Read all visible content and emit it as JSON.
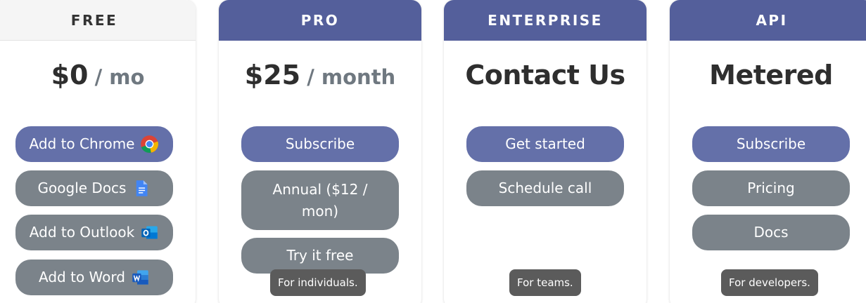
{
  "plans": {
    "free": {
      "header": "FREE",
      "price_amount": "$0",
      "price_period": "/ mo",
      "buttons": [
        "Add to Chrome",
        "Google Docs",
        "Add to Outlook",
        "Add to Word"
      ],
      "icons": [
        "chrome-icon",
        "google-docs-icon",
        "outlook-icon",
        "word-icon"
      ]
    },
    "pro": {
      "header": "PRO",
      "price_amount": "$25",
      "price_period": "/ month",
      "buttons": [
        "Subscribe",
        "Annual ($12 / mon)",
        "Try it free"
      ],
      "badge": "For individuals."
    },
    "enterprise": {
      "header": "ENTERPRISE",
      "price_text": "Contact Us",
      "buttons": [
        "Get started",
        "Schedule call"
      ],
      "badge": "For teams."
    },
    "api": {
      "header": "API",
      "price_text": "Metered",
      "buttons": [
        "Subscribe",
        "Pricing",
        "Docs"
      ],
      "badge": "For developers."
    }
  },
  "colors": {
    "header_accent": "#545f9b",
    "primary_button": "#6470a9",
    "secondary_button": "#7b838a",
    "badge": "#5b5b5b"
  }
}
